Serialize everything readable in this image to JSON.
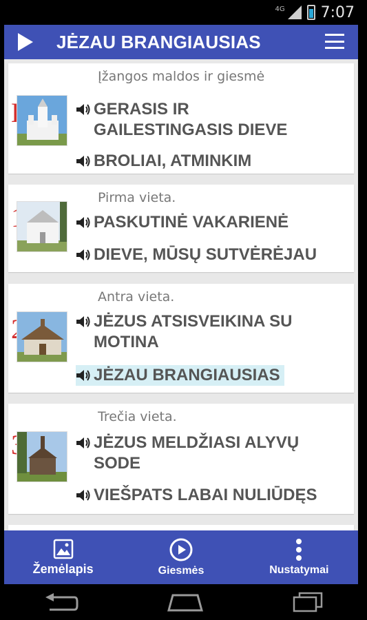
{
  "status_bar": {
    "network": "4G",
    "time": "7:07"
  },
  "app_bar": {
    "title": "JĖZAU BRANGIAUSIAS"
  },
  "cards": [
    {
      "header": "Įžangos maldos ir giesmė",
      "mark": "B",
      "songs": [
        "GERASIS IR GAILESTINGASIS DIEVE",
        "BROLIAI, ATMINKIM"
      ]
    },
    {
      "header": "Pirma vieta.",
      "mark": "1",
      "songs": [
        "PASKUTINĖ VAKARIENĖ",
        "DIEVE, MŪSŲ SUTVĖRĖJAU"
      ]
    },
    {
      "header": "Antra vieta.",
      "mark": "2",
      "songs": [
        "JĖZUS ATSISVEIKINA SU MOTINA",
        "JĖZAU BRANGIAUSIAS"
      ]
    },
    {
      "header": "Trečia vieta.",
      "mark": "3",
      "songs": [
        "JĖZUS MELDŽIASI ALYVŲ SODE",
        "VIEŠPATS LABAI NULIŪDĘS"
      ]
    }
  ],
  "bottom_nav": {
    "map_label": "Žemėlapis",
    "songs_label": "Giesmės",
    "settings_label": "Nustatymai"
  },
  "colors": {
    "primary": "#3f51b5",
    "mark": "#d32f2f",
    "active_highlight": "#d6eff5"
  }
}
